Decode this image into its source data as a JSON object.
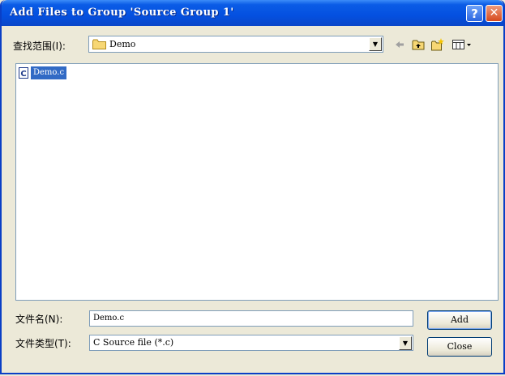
{
  "window": {
    "title": "Add Files to Group 'Source Group 1'"
  },
  "title_buttons": {
    "help": "?",
    "close": "✕"
  },
  "look_in": {
    "label": "查找范围(I):",
    "value": "Demo"
  },
  "toolbar": {
    "icons": [
      "back-arrow-icon",
      "up-folder-icon",
      "new-folder-icon",
      "view-menu-icon"
    ]
  },
  "file_list": {
    "items": [
      {
        "name": "Demo.c",
        "icon": "c-source-file-icon",
        "selected": true
      }
    ]
  },
  "file_name": {
    "label": "文件名(N):",
    "value": "Demo.c"
  },
  "file_type": {
    "label": "文件类型(T):",
    "value": "C Source file (*.c)"
  },
  "buttons": {
    "add": "Add",
    "close": "Close"
  },
  "colors": {
    "title_bar": "#0450e0",
    "selection": "#316ac5",
    "dialog_bg": "#ece9d8"
  }
}
